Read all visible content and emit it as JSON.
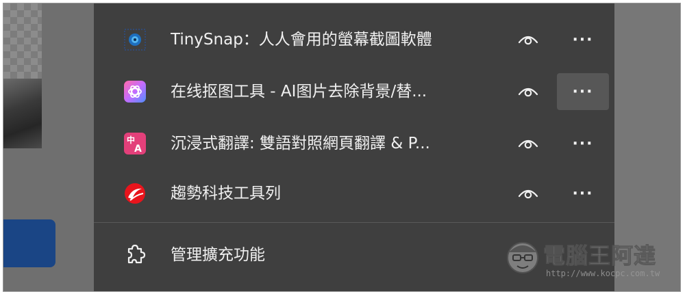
{
  "extensions": [
    {
      "name": "TinySnap：人人會用的螢幕截圖軟體",
      "icon": "tinysnap-icon"
    },
    {
      "name": "在线抠图工具 - AI图片去除背景/替...",
      "icon": "openai-style-swirl-icon"
    },
    {
      "name": "沉浸式翻譯: 雙語對照網頁翻譯 & P...",
      "icon": "translate-icon"
    },
    {
      "name": "趨勢科技工具列",
      "icon": "trend-micro-icon"
    }
  ],
  "more_label": "···",
  "manage": {
    "label": "管理擴充功能",
    "icon": "puzzle-piece-icon"
  },
  "watermark": {
    "title": "電腦王阿達",
    "url": "http://www.kocpc.com.tw"
  },
  "colors": {
    "menu_bg": "#3f3f3f",
    "hover_bg": "#575757",
    "text": "#f0f0f0",
    "accent_blue": "#1a4585"
  }
}
